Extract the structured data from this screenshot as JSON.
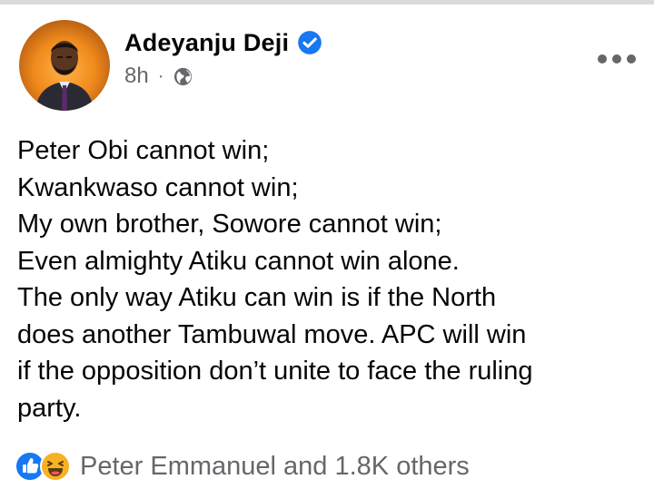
{
  "post": {
    "author": "Adeyanju Deji",
    "time": "8h",
    "separator": "·",
    "lines": [
      "Peter Obi cannot win;",
      "Kwankwaso cannot win;",
      "My own brother, Sowore cannot win;",
      "Even almighty Atiku cannot win alone.",
      "The only way Atiku can win is if the North",
      "does another Tambuwal move. APC will win",
      "if the opposition don’t unite to face the ruling",
      "party."
    ]
  },
  "reactions": {
    "icons": [
      "like-icon",
      "haha-icon"
    ],
    "summary": "Peter Emmanuel and 1.8K others"
  },
  "colors": {
    "text": "#050505",
    "secondary": "#65676b",
    "verified": "#1877f2",
    "like": "#1877f2",
    "haha": "#f7b125"
  }
}
